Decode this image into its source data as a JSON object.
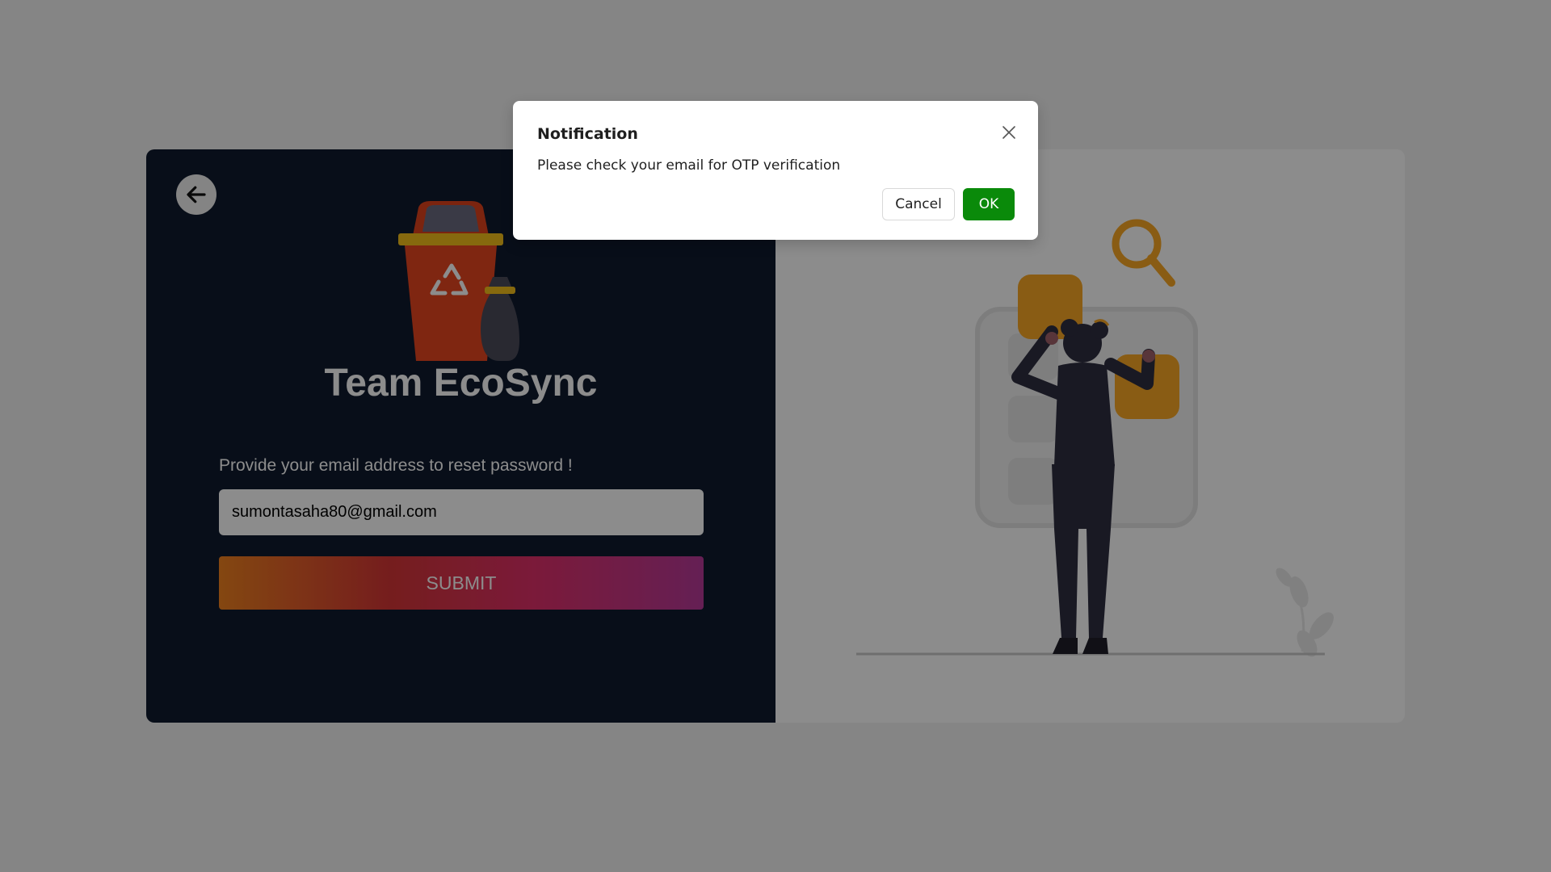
{
  "login_card": {
    "back_button_icon": "arrow-left-icon",
    "logo_icon": "recycle-bin-icon",
    "brand_title": "Team EcoSync",
    "prompt_label": "Provide your email address to reset password !",
    "email_input": {
      "value": "sumontasaha80@gmail.com",
      "placeholder": ""
    },
    "submit_label": "SUBMIT",
    "illustration_icon": "person-searching-illustration"
  },
  "modal": {
    "title": "Notification",
    "message": "Please check your email for OTP verification",
    "close_icon": "close-icon",
    "cancel_label": "Cancel",
    "ok_label": "OK"
  },
  "colors": {
    "page_backdrop": "#222222",
    "left_panel": "#0f1a2e",
    "ok_button": "#0a8a0a",
    "submit_gradient": [
      "#f0821f",
      "#d63636",
      "#e0306a",
      "#b83a9a"
    ],
    "accent_illustration": "#f9a825"
  }
}
